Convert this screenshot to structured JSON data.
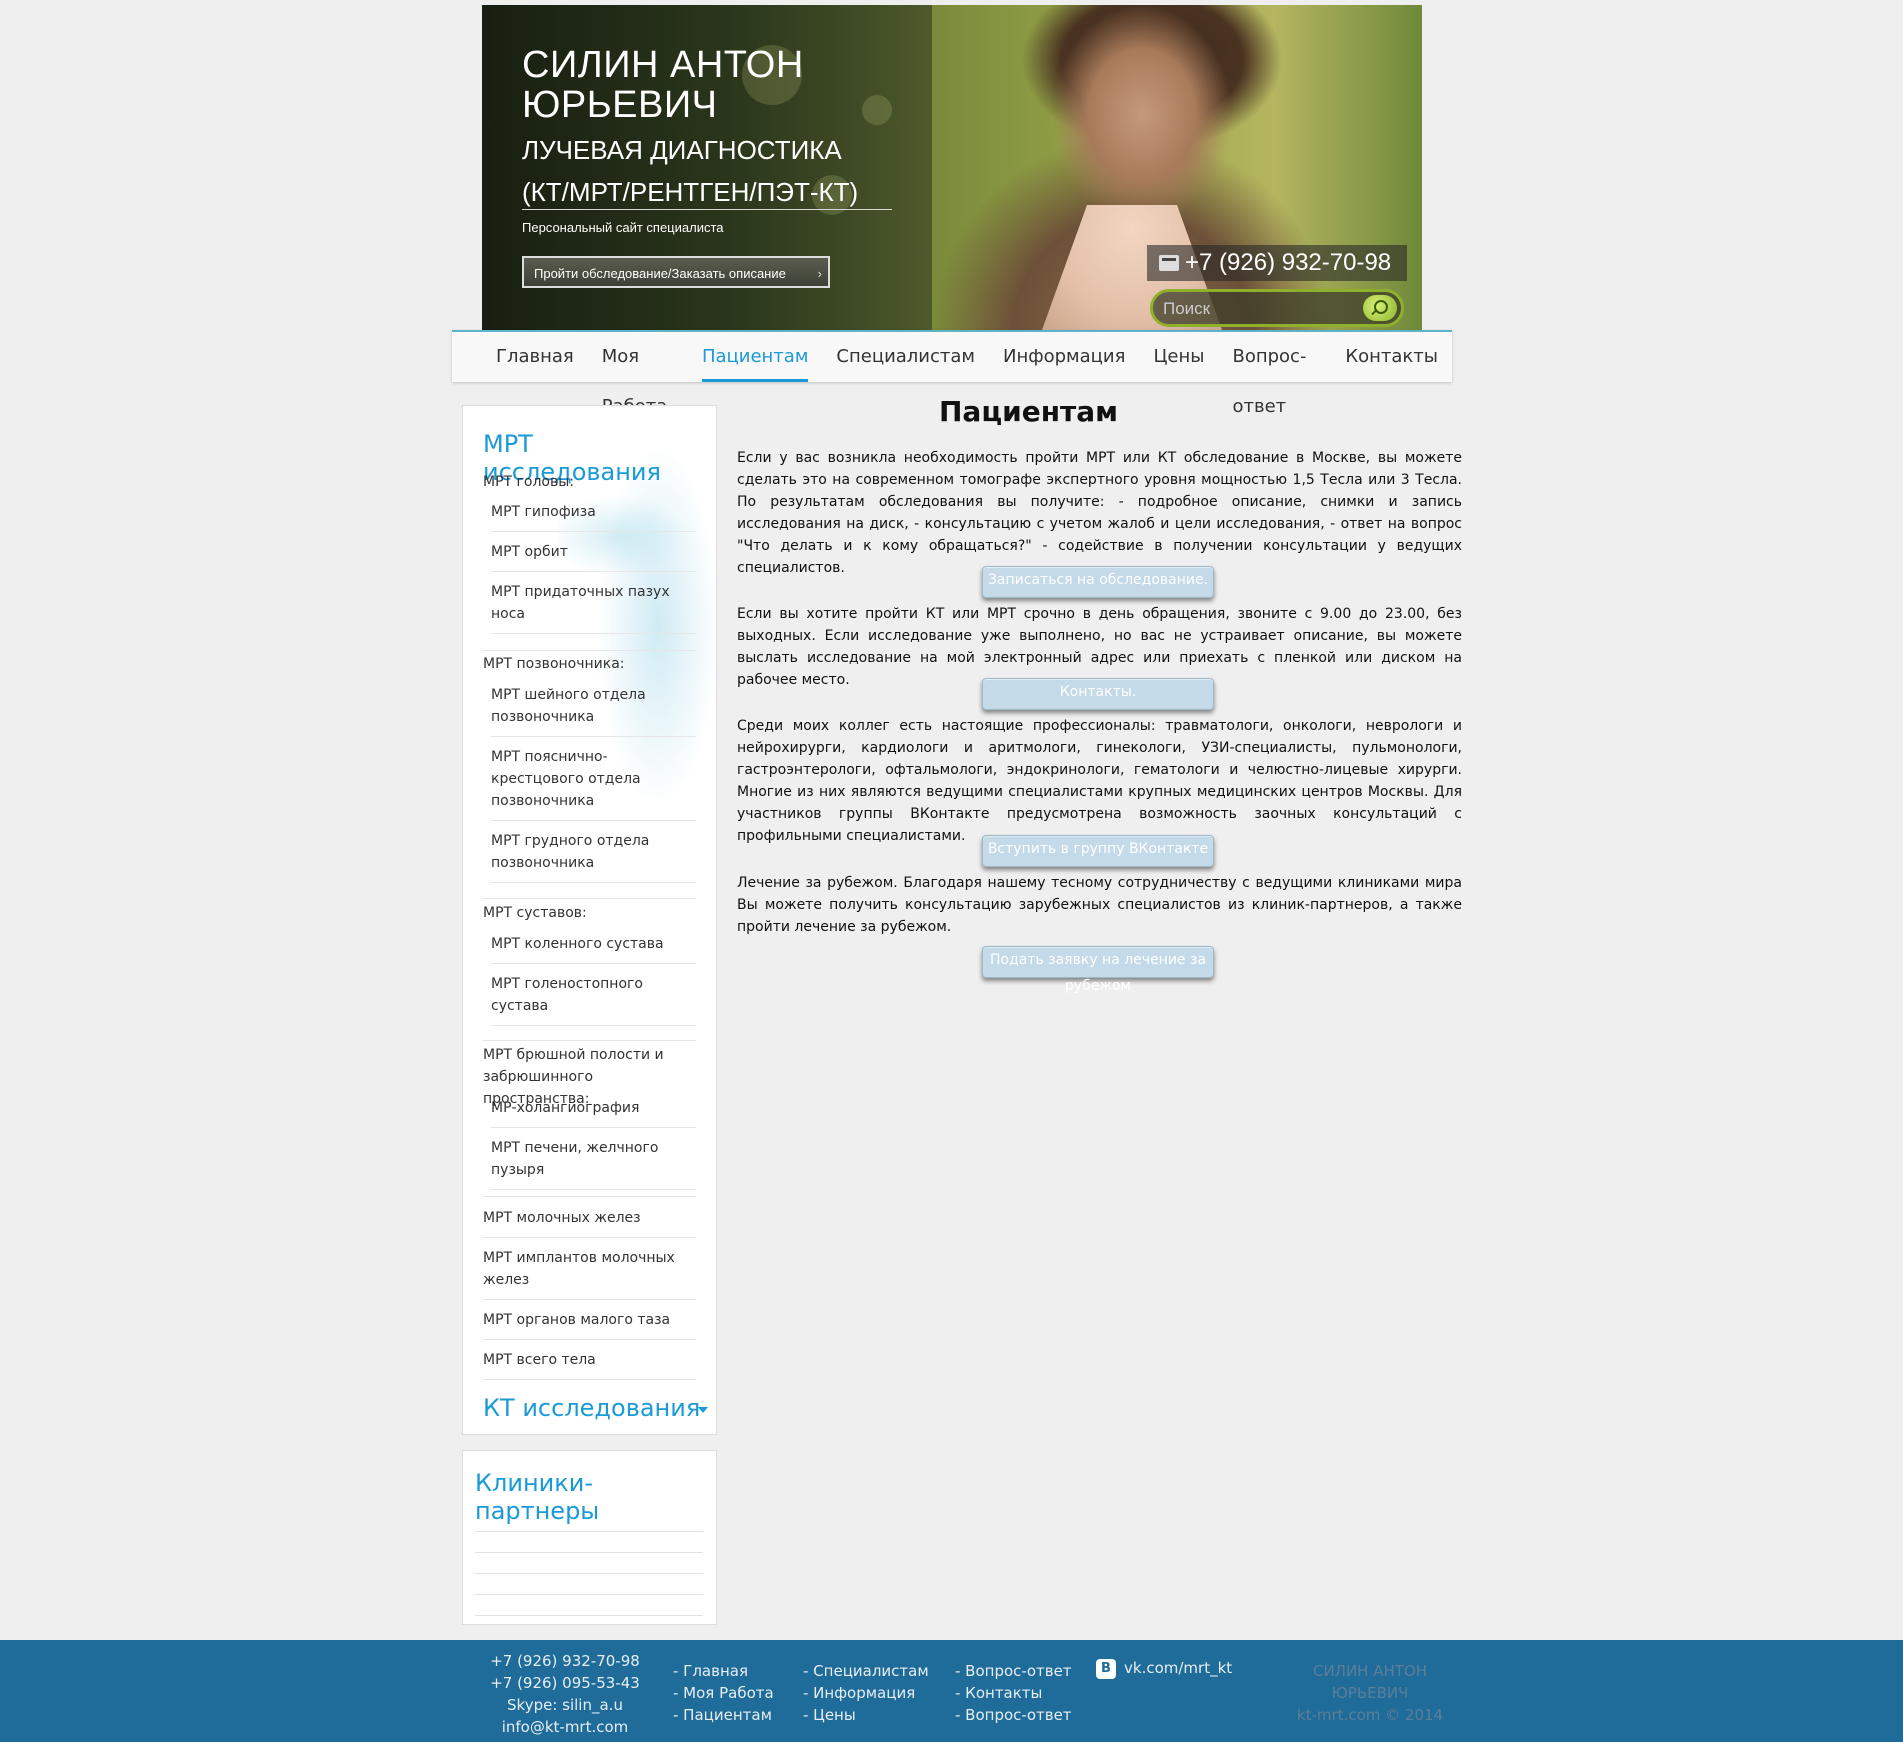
{
  "header": {
    "name": "СИЛИН АНТОН ЮРЬЕВИЧ",
    "specialty_line1": "ЛУЧЕВАЯ ДИАГНОСТИКА",
    "specialty_line2": "(КТ/МРТ/РЕНТГЕН/ПЭТ-КТ)",
    "subtitle": "Персональный сайт специалиста",
    "cta_label": "Пройти обследование/Заказать описание",
    "phone": "+7 (926) 932-70-98",
    "search_placeholder": "Поиск"
  },
  "nav": {
    "items": [
      "Главная",
      "Моя Работа",
      "Пациентам",
      "Специалистам",
      "Информация",
      "Цены",
      "Вопрос-ответ",
      "Контакты"
    ],
    "active": "Пациентам"
  },
  "sidebar": {
    "mrt_title": "МРТ исследования",
    "groups": {
      "head": "МРТ головы:",
      "spine": "МРТ позвоночника:",
      "joints": "МРТ суставов:",
      "abdomen": "МРТ брюшной полости и забрюшинного пространства:"
    },
    "items": {
      "pituitary": "МРТ гипофиза",
      "orbits": "МРТ орбит",
      "sinuses": "МРТ придаточных пазух носа",
      "cervical": "МРТ шейного отдела позвоночника",
      "lumbosacral": "МРТ пояснично-крестцового отдела позвоночника",
      "thoracic": "МРТ грудного отдела позвоночника",
      "knee": "МРТ коленного сустава",
      "ankle": "МРТ голеностопного сустава",
      "cholangio": "МР-холангиография",
      "liver": "МРТ печени, желчного пузыря",
      "breast": "МРТ молочных желез",
      "implants": "МРТ имплантов молочных желез",
      "pelvis": "МРТ органов малого таза",
      "wholebody": "МРТ всего тела"
    },
    "kt_title": "КТ исследования",
    "partners_title": "Клиники-партнеры"
  },
  "content": {
    "title": "Пациентам",
    "p1": "Если у вас возникла необходимость пройти МРТ или КТ обследование в Москве, вы можете сделать это на современном томографе экспертного уровня мощностью 1,5 Тесла или 3 Тесла. По результатам обследования вы получите: - подробное описание, снимки и запись исследования на диск, - консультацию с учетом жалоб и цели исследования, - ответ на вопрос \"Что делать и к кому обращаться?\" - содействие в получении консультации у ведущих специалистов.",
    "btn1": "Записаться на обследование.",
    "p2": "Если вы хотите пройти КТ или МРТ срочно в день обращения, звоните с 9.00 до 23.00, без выходных. Если исследование уже выполнено, но вас не устраивает описание, вы можете выслать исследование на мой электронный адрес или приехать с пленкой или диском на рабочее место.",
    "btn2": "Контакты.",
    "p3": "Среди моих коллег есть настоящие профессионалы: травматологи, онкологи, неврологи и нейрохирурги, кардиологи и аритмологи, гинекологи, УЗИ-специалисты, пульмонологи, гастроэнтерологи, офтальмологи, эндокринологи, гематологи и челюстно-лицевые хирурги. Многие из них являются ведущими специалистами крупных медицинских центров Москвы. Для участников группы ВКонтакте предусмотрена возможность заочных консультаций с профильными специалистами.",
    "btn3": "Вступить в группу ВКонтакте",
    "p4": "Лечение за рубежом. Благодаря нашему тесному сотрудничеству с ведущими клиниками мира Вы можете получить консультацию зарубежных специалистов из клиник-партнеров, а также пройти лечение за рубежом.",
    "btn4": "Подать заявку на лечение за рубежом"
  },
  "footer": {
    "phone1": "+7 (926) 932-70-98",
    "phone2": "+7 (926) 095-53-43",
    "skype": "Skype: silin_a.u",
    "email": "info@kt-mrt.com",
    "col1": [
      "- Главная",
      "- Моя Работа",
      "- Пациентам"
    ],
    "col2": [
      "- Специалистам",
      "- Информация",
      "- Цены"
    ],
    "col3": [
      "- Вопрос-ответ",
      "- Контакты",
      "- Вопрос-ответ"
    ],
    "vk_icon_letter": "В",
    "vk_link": "vk.com/mrt_kt",
    "copy_name": "СИЛИН АНТОН ЮРЬЕВИЧ",
    "copy": "kt-mrt.com © 2014"
  },
  "colors": {
    "accent": "#1a9ad6",
    "footer_bg": "#1f6b9a",
    "button_bg": "#c4dae8",
    "search_border": "#8fb02c"
  }
}
